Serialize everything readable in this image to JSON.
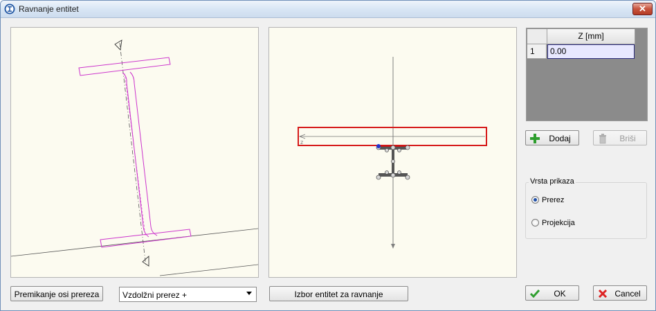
{
  "window": {
    "title": "Ravnanje entitet",
    "close_label": "✕"
  },
  "grid": {
    "column_header": "Z [mm]",
    "rows": [
      {
        "index": "1",
        "value": "0.00"
      }
    ]
  },
  "buttons": {
    "add": "Dodaj",
    "delete": "Briši",
    "move_axis": "Premikanje osi prereza",
    "select_entities": "Izbor entitet za ravnanje",
    "ok": "OK",
    "cancel": "Cancel"
  },
  "section_select": {
    "value": "Vzdolžni prerez +"
  },
  "display_group": {
    "title": "Vrsta prikaza",
    "options": [
      {
        "label": "Prerez",
        "checked": true
      },
      {
        "label": "Projekcija",
        "checked": false
      }
    ]
  },
  "colors": {
    "canvas_bg": "#fcfbf0",
    "profile": "#cc33cc",
    "highlight_box": "#d61a1a"
  },
  "icons": {
    "add": "green-plus-icon",
    "delete": "trash-icon",
    "ok": "green-check-icon",
    "cancel": "red-x-icon"
  }
}
